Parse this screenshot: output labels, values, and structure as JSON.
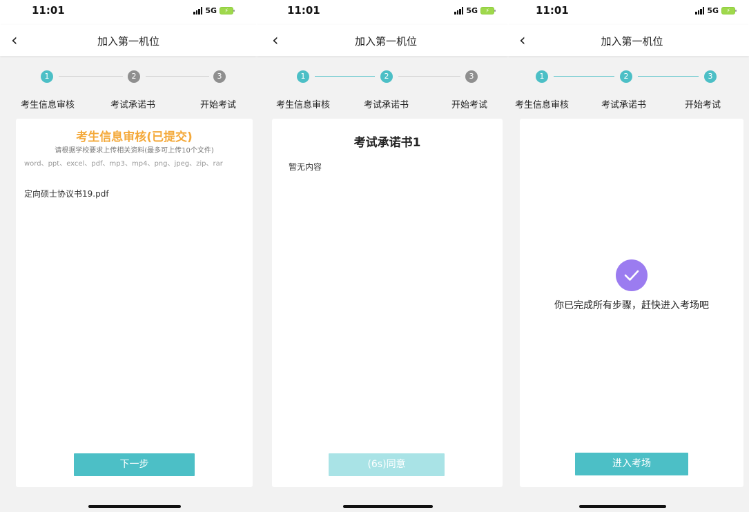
{
  "status": {
    "time": "11:01",
    "network": "5G"
  },
  "nav": {
    "title": "加入第一机位"
  },
  "steps": [
    {
      "number": "1",
      "label": "考生信息审核"
    },
    {
      "number": "2",
      "label": "考试承诺书"
    },
    {
      "number": "3",
      "label": "开始考试"
    }
  ],
  "screen1": {
    "title": "考生信息审核(已提交)",
    "subtitle": "请根据学校要求上传相关资料(最多可上传10个文件)",
    "file_types": "word、ppt、excel、pdf、mp3、mp4、png、jpeg、zip、rar",
    "file_name": "定向硕士协议书19.pdf",
    "next_label": "下一步"
  },
  "screen2": {
    "title": "考试承诺书1",
    "body": "暂无内容",
    "agree_label": "(6s)同意"
  },
  "screen3": {
    "message": "你已完成所有步骤，赶快进入考场吧",
    "enter_label": "进入考场"
  },
  "colors": {
    "accent": "#4cbfc6",
    "accent_disabled": "#a9e3e6",
    "title_orange": "#f4a93a",
    "check_purple": "#9b7cf0",
    "step_idle": "#8f8f8f"
  },
  "icons": [
    "back-chevron-icon",
    "signal-icon",
    "battery-icon",
    "checkmark-icon"
  ]
}
